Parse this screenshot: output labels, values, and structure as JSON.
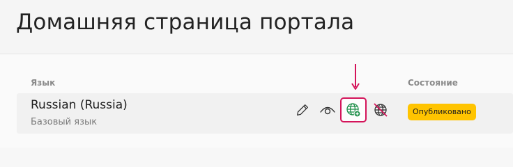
{
  "page": {
    "title": "Домашняя страница портала"
  },
  "table": {
    "columns": {
      "language": "Язык",
      "state": "Состояние"
    },
    "rows": [
      {
        "language": "Russian (Russia)",
        "subtitle": "Базовый язык",
        "status": "Опубликовано"
      }
    ]
  },
  "icons": {
    "edit": "pencil-icon",
    "view": "eye-icon",
    "publish": "globe-plus-icon",
    "unpublish": "globe-crossed-icon",
    "pointer": "down-arrow-icon"
  },
  "colors": {
    "highlight": "#d4145a",
    "status": "#ffc400",
    "publish_icon": "#1f8f4a"
  }
}
